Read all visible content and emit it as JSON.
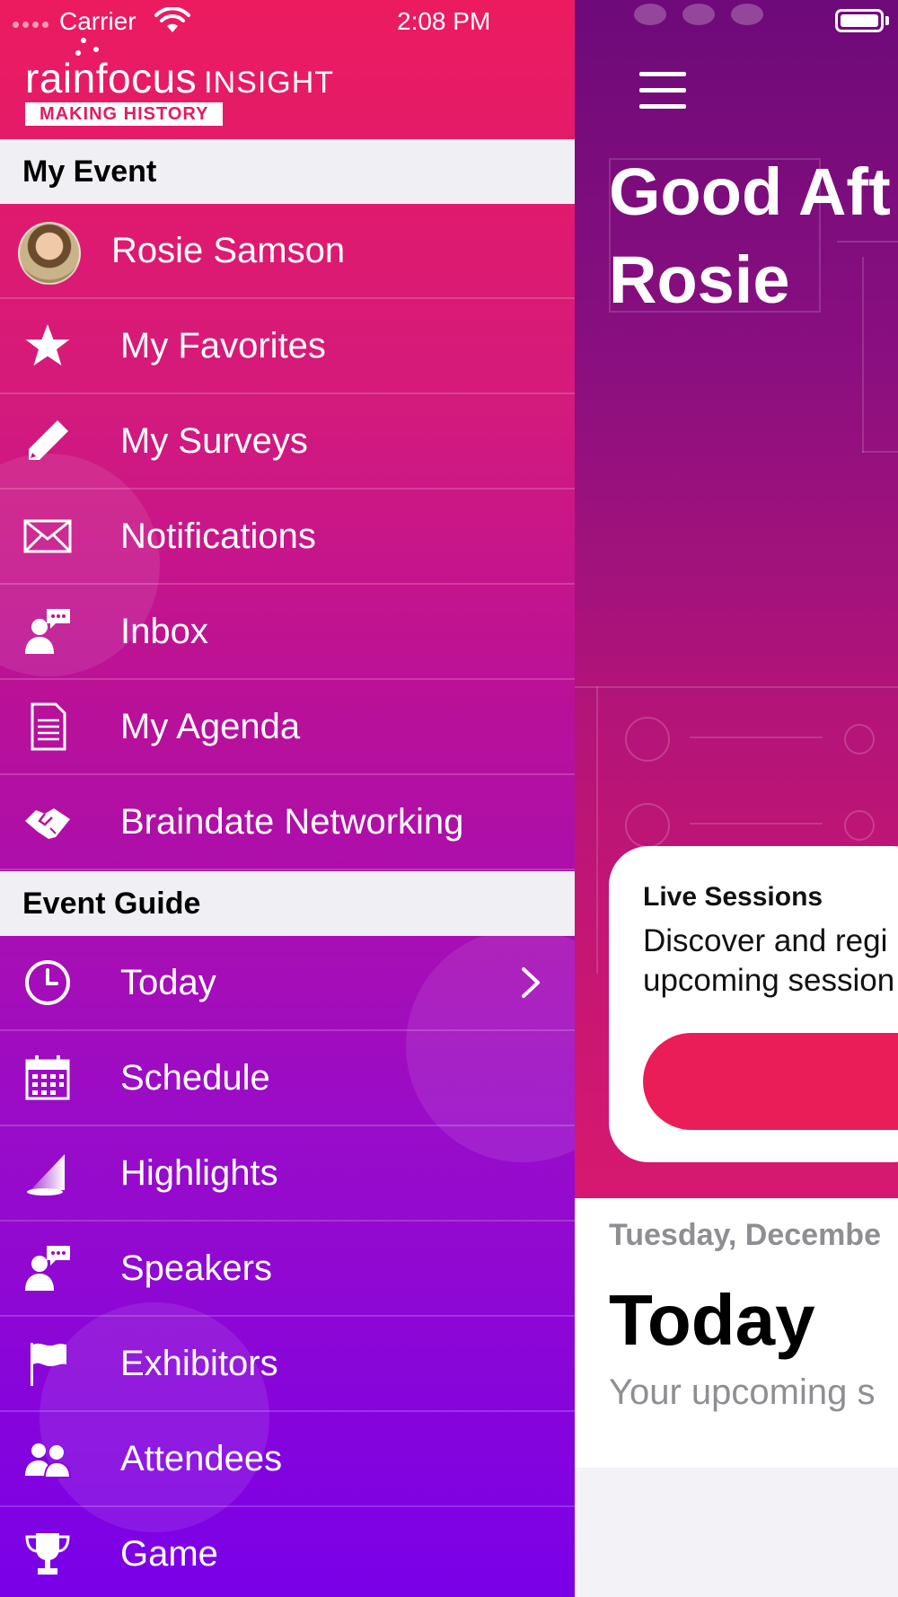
{
  "status_bar": {
    "carrier": "Carrier",
    "time": "2:08 PM"
  },
  "logo": {
    "wordmark": "rainfocus",
    "suffix": "INSIGHT",
    "tagline": "MAKING HISTORY"
  },
  "drawer": {
    "section_my_event": "My Event",
    "profile": {
      "name": "Rosie Samson"
    },
    "my_event_items": [
      {
        "label": "My Favorites",
        "icon": "star-icon"
      },
      {
        "label": "My Surveys",
        "icon": "pencil-icon"
      },
      {
        "label": "Notifications",
        "icon": "envelope-icon"
      },
      {
        "label": "Inbox",
        "icon": "chat-person-icon"
      },
      {
        "label": "My Agenda",
        "icon": "document-icon"
      },
      {
        "label": "Braindate Networking",
        "icon": "handshake-icon"
      }
    ],
    "section_event_guide": "Event Guide",
    "event_guide_items": [
      {
        "label": "Today",
        "icon": "clock-icon"
      },
      {
        "label": "Schedule",
        "icon": "calendar-icon"
      },
      {
        "label": "Highlights",
        "icon": "spotlight-icon"
      },
      {
        "label": "Speakers",
        "icon": "speaker-icon"
      },
      {
        "label": "Exhibitors",
        "icon": "flag-icon"
      },
      {
        "label": "Attendees",
        "icon": "people-icon"
      },
      {
        "label": "Game",
        "icon": "trophy-icon"
      }
    ]
  },
  "main": {
    "greeting_line1": "Good Aft",
    "greeting_line2": "Rosie",
    "card": {
      "title": "Live Sessions",
      "description_line1": "Discover and regi",
      "description_line2": "upcoming session"
    },
    "today": {
      "date": "Tuesday, Decembe",
      "title": "Today",
      "subtitle": "Your upcoming s"
    }
  },
  "colors": {
    "accent": "#ea1d59",
    "drawer_top": "#ec1b5f",
    "drawer_bottom": "#7a00e8",
    "header_bg": "#efeff4"
  }
}
